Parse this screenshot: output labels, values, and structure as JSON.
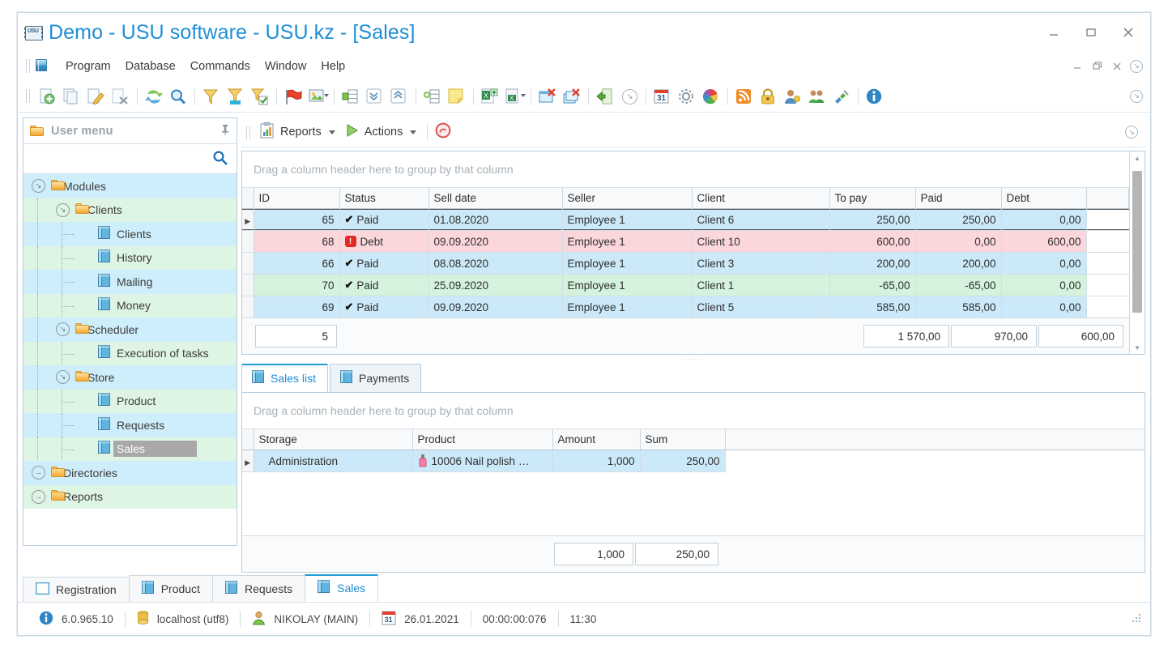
{
  "window": {
    "title": "Demo - USU software - USU.kz - [Sales]",
    "app_icon": "usu-logo-icon",
    "minimize": "–",
    "maximize": "□",
    "close": "×"
  },
  "menubar": {
    "items": [
      "Program",
      "Database",
      "Commands",
      "Window",
      "Help"
    ],
    "mdi_minimize": "–",
    "mdi_restore": "❐",
    "mdi_close": "×"
  },
  "toolbar": {
    "groups": [
      [
        "add-record-icon",
        "copy-record-icon",
        "edit-record-icon",
        "delete-record-icon"
      ],
      [
        "refresh-icon",
        "search-icon"
      ],
      [
        "filter-icon",
        "filter-clear-icon",
        "filter-apply-icon"
      ],
      [
        "flag-icon",
        "image-icon"
      ],
      [
        "group-icon",
        "expand-all-icon",
        "collapse-all-icon"
      ],
      [
        "add-column-icon",
        "note-icon"
      ],
      [
        "export-excel-icon",
        "export-file-icon"
      ],
      [
        "window-close-icon",
        "window-close-all-icon"
      ],
      [
        "exit-icon",
        "minimize-all-icon"
      ],
      [
        "calendar-icon",
        "settings-icon",
        "color-icon"
      ],
      [
        "rss-icon",
        "lock-icon",
        "user-rights-icon",
        "users-icon",
        "plugin-icon"
      ],
      [
        "info-icon"
      ]
    ]
  },
  "sidebar": {
    "header": "User menu",
    "pin_icon": "pin-icon",
    "search_placeholder": "",
    "search_value": "",
    "search_icon": "search-icon",
    "tree": [
      {
        "label": "Modules",
        "level": 0,
        "type": "folder",
        "expanded": true,
        "bg": "b"
      },
      {
        "label": "Clients",
        "level": 1,
        "type": "folder",
        "expanded": true,
        "bg": "g"
      },
      {
        "label": "Clients",
        "level": 2,
        "type": "book",
        "bg": "b"
      },
      {
        "label": "History",
        "level": 2,
        "type": "book",
        "bg": "g"
      },
      {
        "label": "Mailing",
        "level": 2,
        "type": "book",
        "bg": "b"
      },
      {
        "label": "Money",
        "level": 2,
        "type": "book",
        "bg": "g"
      },
      {
        "label": "Scheduler",
        "level": 1,
        "type": "folder",
        "expanded": true,
        "bg": "b"
      },
      {
        "label": "Execution of tasks",
        "level": 2,
        "type": "book",
        "bg": "g"
      },
      {
        "label": "Store",
        "level": 1,
        "type": "folder",
        "expanded": true,
        "bg": "b"
      },
      {
        "label": "Product",
        "level": 2,
        "type": "book",
        "bg": "g"
      },
      {
        "label": "Requests",
        "level": 2,
        "type": "book",
        "bg": "b"
      },
      {
        "label": "Sales",
        "level": 2,
        "type": "book",
        "bg": "g",
        "selected": true
      },
      {
        "label": "Directories",
        "level": 0,
        "type": "folder",
        "expanded": false,
        "bg": "b"
      },
      {
        "label": "Reports",
        "level": 0,
        "type": "folder",
        "expanded": false,
        "bg": "g"
      }
    ]
  },
  "content_toolbar": {
    "reports_label": "Reports",
    "reports_icon": "report-icon",
    "actions_label": "Actions",
    "actions_icon": "play-icon",
    "cancel_icon": "cancel-icon"
  },
  "sales_grid": {
    "group_panel_text": "Drag a column header here to group by that column",
    "columns": [
      "ID",
      "Status",
      "Sell date",
      "Seller",
      "Client",
      "To pay",
      "Paid",
      "Debt"
    ],
    "rows": [
      {
        "id": "65",
        "status": "Paid",
        "status_icon": "check-icon",
        "sell_date": "01.08.2020",
        "seller": "Employee 1",
        "client": "Client 6",
        "to_pay": "250,00",
        "paid": "250,00",
        "debt": "0,00",
        "color": "blue",
        "current": true
      },
      {
        "id": "68",
        "status": "Debt",
        "status_icon": "error-icon",
        "sell_date": "09.09.2020",
        "seller": "Employee 1",
        "client": "Client 10",
        "to_pay": "600,00",
        "paid": "0,00",
        "debt": "600,00",
        "color": "pink",
        "current": false
      },
      {
        "id": "66",
        "status": "Paid",
        "status_icon": "check-icon",
        "sell_date": "08.08.2020",
        "seller": "Employee 1",
        "client": "Client 3",
        "to_pay": "200,00",
        "paid": "200,00",
        "debt": "0,00",
        "color": "blue",
        "current": false
      },
      {
        "id": "70",
        "status": "Paid",
        "status_icon": "check-icon",
        "sell_date": "25.09.2020",
        "seller": "Employee 1",
        "client": "Client 1",
        "to_pay": "-65,00",
        "paid": "-65,00",
        "debt": "0,00",
        "color": "green",
        "current": false
      },
      {
        "id": "69",
        "status": "Paid",
        "status_icon": "check-icon",
        "sell_date": "09.09.2020",
        "seller": "Employee 1",
        "client": "Client 5",
        "to_pay": "585,00",
        "paid": "585,00",
        "debt": "0,00",
        "color": "blue",
        "current": false
      }
    ],
    "summary": {
      "count": "5",
      "to_pay": "1 570,00",
      "paid": "970,00",
      "debt": "600,00"
    }
  },
  "detail_tabs": [
    {
      "label": "Sales list",
      "icon": "book-icon",
      "active": true
    },
    {
      "label": "Payments",
      "icon": "book-icon",
      "active": false
    }
  ],
  "detail_grid": {
    "group_panel_text": "Drag a column header here to group by that column",
    "columns": [
      "Storage",
      "Product",
      "Amount",
      "Sum"
    ],
    "rows": [
      {
        "storage": "Administration",
        "product": "10006 Nail polish …",
        "product_icon": "nail-polish-icon",
        "amount": "1,000",
        "sum": "250,00",
        "color": "blue",
        "current": true
      }
    ],
    "summary": {
      "amount": "1,000",
      "sum": "250,00"
    }
  },
  "window_tabs": [
    {
      "label": "Registration",
      "icon": "window-icon",
      "active": false
    },
    {
      "label": "Product",
      "icon": "book-icon",
      "active": false
    },
    {
      "label": "Requests",
      "icon": "book-icon",
      "active": false
    },
    {
      "label": "Sales",
      "icon": "book-icon",
      "active": true
    }
  ],
  "statusbar": {
    "info_icon": "info-icon",
    "version": "6.0.965.10",
    "db_icon": "database-icon",
    "server": "localhost (utf8)",
    "user_icon": "user-icon",
    "user": "NIKOLAY (MAIN)",
    "calendar_icon": "calendar-icon",
    "date": "26.01.2021",
    "elapsed": "00:00:00:076",
    "time": "11:30",
    "resize_grip": "resize-grip-icon"
  },
  "colors": {
    "accent": "#1f8fd6",
    "row_blue": "#cbe9f8",
    "row_pink": "#fbd7dc",
    "row_green": "#d4f2dc",
    "error_red": "#e02b27",
    "border": "#b8cddd"
  }
}
